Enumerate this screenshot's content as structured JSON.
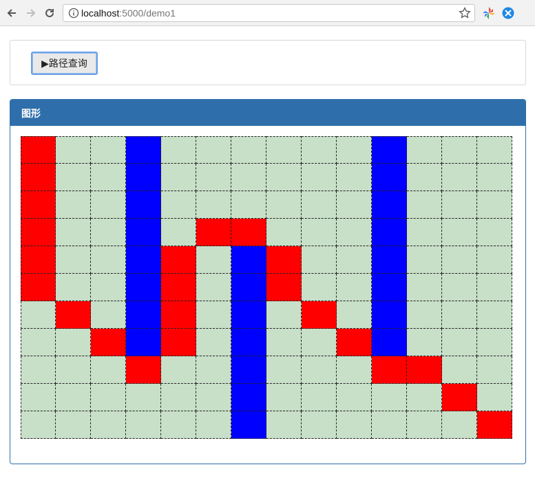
{
  "browser": {
    "url_host": "localhost",
    "url_path": ":5000/demo1"
  },
  "toolbar": {
    "query_button_label": "▶路径查询"
  },
  "graph": {
    "title": "图形",
    "colors": {
      "empty": "#c8dfc8",
      "path": "#ff0000",
      "obstacle": "#0000ff"
    },
    "legend_codes": {
      "0": "empty",
      "1": "path",
      "2": "obstacle"
    },
    "grid": [
      [
        1,
        0,
        0,
        2,
        0,
        0,
        0,
        0,
        0,
        0,
        2,
        0,
        0,
        0
      ],
      [
        1,
        0,
        0,
        2,
        0,
        0,
        0,
        0,
        0,
        0,
        2,
        0,
        0,
        0
      ],
      [
        1,
        0,
        0,
        2,
        0,
        0,
        0,
        0,
        0,
        0,
        2,
        0,
        0,
        0
      ],
      [
        1,
        0,
        0,
        2,
        0,
        1,
        1,
        0,
        0,
        0,
        2,
        0,
        0,
        0
      ],
      [
        1,
        0,
        0,
        2,
        1,
        0,
        2,
        1,
        0,
        0,
        2,
        0,
        0,
        0
      ],
      [
        1,
        0,
        0,
        2,
        1,
        0,
        2,
        1,
        0,
        0,
        2,
        0,
        0,
        0
      ],
      [
        0,
        1,
        0,
        2,
        1,
        0,
        2,
        0,
        1,
        0,
        2,
        0,
        0,
        0
      ],
      [
        0,
        0,
        1,
        2,
        1,
        0,
        2,
        0,
        0,
        1,
        2,
        0,
        0,
        0
      ],
      [
        0,
        0,
        0,
        1,
        0,
        0,
        2,
        0,
        0,
        0,
        1,
        1,
        0,
        0
      ],
      [
        0,
        0,
        0,
        0,
        0,
        0,
        2,
        0,
        0,
        0,
        0,
        0,
        1,
        0
      ],
      [
        0,
        0,
        0,
        0,
        0,
        0,
        2,
        0,
        0,
        0,
        0,
        0,
        0,
        1
      ]
    ]
  }
}
